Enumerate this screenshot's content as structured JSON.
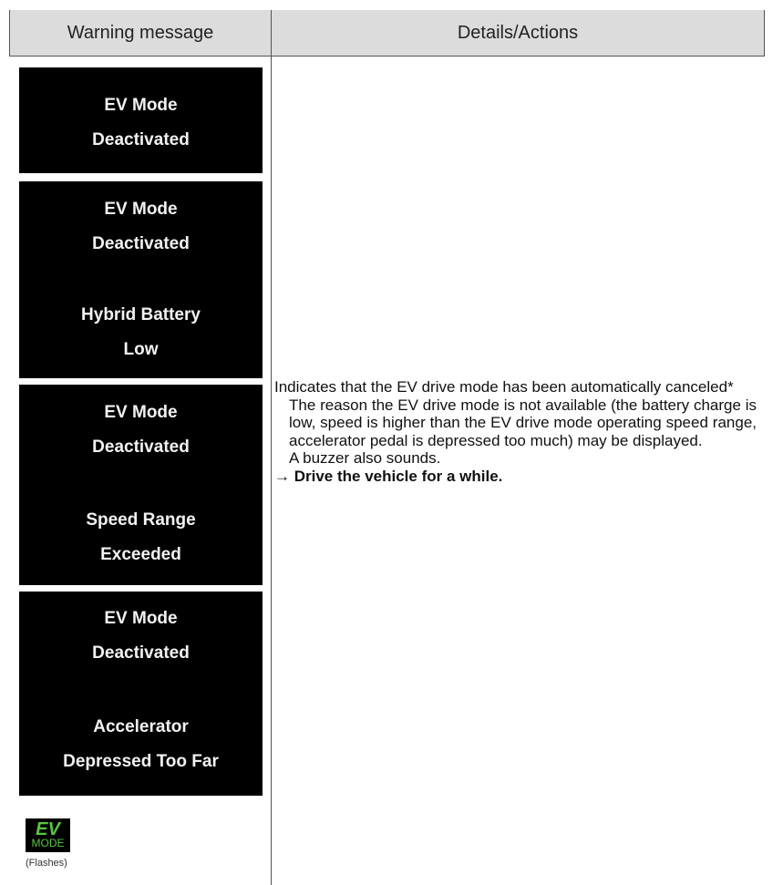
{
  "table": {
    "header": {
      "col1": "Warning message",
      "col2": "Details/Actions"
    }
  },
  "panels": [
    {
      "lines": [
        "EV Mode",
        "Deactivated"
      ]
    },
    {
      "lines": [
        "EV Mode",
        "Deactivated",
        "Hybrid Battery",
        "Low"
      ]
    },
    {
      "lines": [
        "EV Mode",
        "Deactivated",
        "Speed Range",
        "Exceeded"
      ]
    },
    {
      "lines": [
        "EV Mode",
        "Deactivated",
        "Accelerator",
        "Depressed Too Far"
      ]
    }
  ],
  "indicator": {
    "line1": "EV",
    "line2": "MODE",
    "color": "#55c73b",
    "caption": "(Flashes)"
  },
  "details": {
    "intro": "Indicates that the EV drive mode has been automatically canceled*",
    "reason": "The reason the EV drive mode is not available (the battery charge is low, speed is higher than the EV drive mode operating speed range, accelerator pedal is depressed too much) may be displayed.",
    "buzzer": "A buzzer also sounds.",
    "action_arrow": "→",
    "action": "Drive the vehicle for a while."
  }
}
